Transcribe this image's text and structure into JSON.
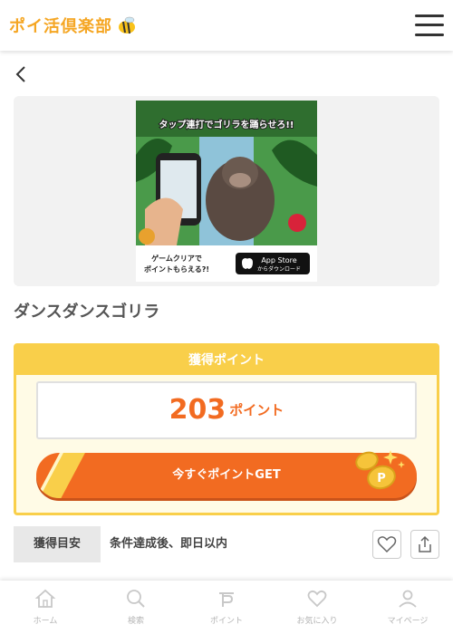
{
  "header": {
    "logo_text": "ポイ活倶楽部",
    "menu_icon": "hamburger-icon"
  },
  "nav": {
    "back_icon": "chevron-left-icon"
  },
  "banner": {
    "headline": "タップ連打でゴリラを踊らせろ!!",
    "cta_line1": "ゲームクリアで",
    "cta_line2": "ポイントもらえる?!",
    "store_badge_top": "App Store",
    "store_badge_bottom": "からダウンロード"
  },
  "offer": {
    "title": "ダンスダンスゴリラ",
    "points_header": "獲得ポイント",
    "points_value": "203",
    "points_unit": "ポイント",
    "get_button": "今すぐポイントGET",
    "period_label": "獲得目安",
    "period_value": "条件達成後、即日以内"
  },
  "tabs": [
    {
      "label": "ホーム",
      "icon": "home-icon"
    },
    {
      "label": "検索",
      "icon": "search-icon"
    },
    {
      "label": "ポイント",
      "icon": "point-icon"
    },
    {
      "label": "お気に入り",
      "icon": "heart-icon"
    },
    {
      "label": "マイページ",
      "icon": "user-icon"
    }
  ],
  "colors": {
    "accent_orange": "#f26b21",
    "accent_yellow": "#f9cf4a",
    "tab_inactive": "#b5b5b5"
  }
}
